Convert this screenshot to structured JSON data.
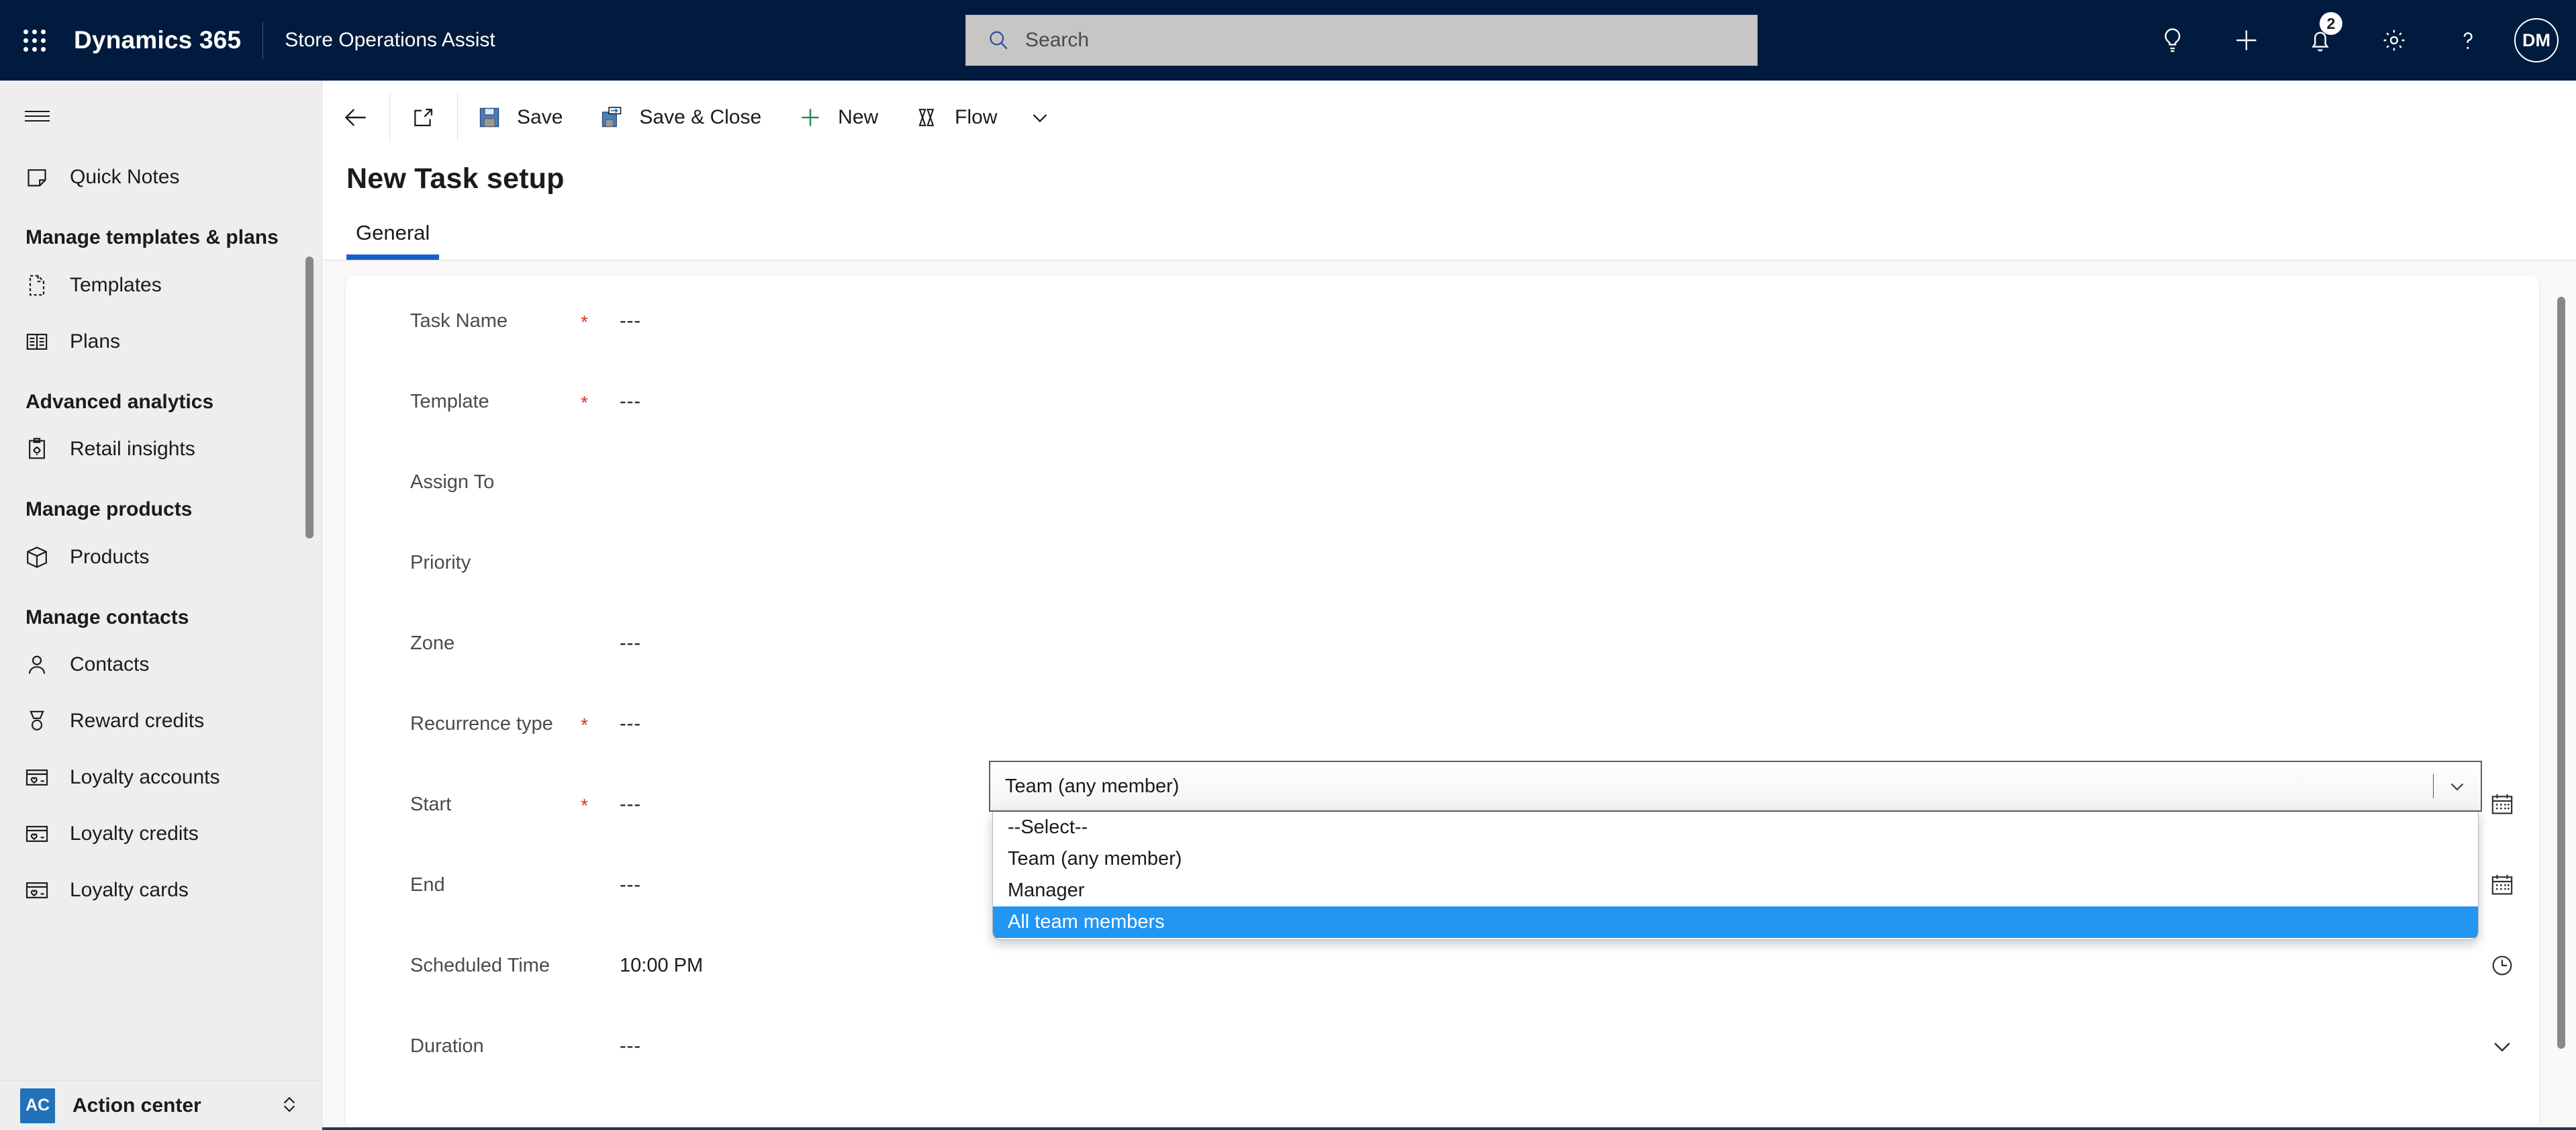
{
  "header": {
    "waffle_icon": "app-launcher-icon",
    "brand": "Dynamics 365",
    "app_name": "Store Operations Assist",
    "search": {
      "placeholder": "Search",
      "value": "",
      "icon": "search-icon"
    },
    "actions": [
      {
        "name": "lightbulb-icon",
        "label": "Insights"
      },
      {
        "name": "plus-icon",
        "label": "New"
      },
      {
        "name": "bell-icon",
        "label": "Notifications",
        "badge": "2"
      },
      {
        "name": "gear-icon",
        "label": "Settings"
      },
      {
        "name": "question-icon",
        "label": "Help"
      }
    ],
    "avatar_initials": "DM"
  },
  "sidebar": {
    "hamburger_icon": "hamburger-icon",
    "items": [
      {
        "type": "item",
        "label": "Quick Notes",
        "icon": "note-icon"
      },
      {
        "type": "group",
        "label": "Manage templates & plans"
      },
      {
        "type": "item",
        "label": "Templates",
        "icon": "document-icon"
      },
      {
        "type": "item",
        "label": "Plans",
        "icon": "plan-icon"
      },
      {
        "type": "group",
        "label": "Advanced analytics"
      },
      {
        "type": "item",
        "label": "Retail insights",
        "icon": "clipboard-gear-icon"
      },
      {
        "type": "group",
        "label": "Manage products"
      },
      {
        "type": "item",
        "label": "Products",
        "icon": "box-icon"
      },
      {
        "type": "group",
        "label": "Manage contacts"
      },
      {
        "type": "item",
        "label": "Contacts",
        "icon": "person-icon"
      },
      {
        "type": "item",
        "label": "Reward credits",
        "icon": "medal-icon"
      },
      {
        "type": "item",
        "label": "Loyalty accounts",
        "icon": "card-heart-icon"
      },
      {
        "type": "item",
        "label": "Loyalty credits",
        "icon": "card-heart-icon"
      },
      {
        "type": "item",
        "label": "Loyalty cards",
        "icon": "card-heart-icon"
      }
    ],
    "footer": {
      "badge": "AC",
      "label": "Action center",
      "chevron_icon": "chevron-up-down-icon"
    }
  },
  "commandbar": {
    "back_icon": "back-arrow-icon",
    "popout_icon": "pop-out-icon",
    "buttons": [
      {
        "label": "Save",
        "icon": "save-icon"
      },
      {
        "label": "Save & Close",
        "icon": "save-close-icon"
      },
      {
        "label": "New",
        "icon": "plus-icon"
      },
      {
        "label": "Flow",
        "icon": "flow-icon"
      }
    ],
    "overflow_icon": "chevron-down-icon"
  },
  "form": {
    "title": "New Task setup",
    "tabs": [
      {
        "label": "General",
        "active": true
      }
    ],
    "rows": [
      {
        "label": "Task Name",
        "required": true,
        "value": "---",
        "icon": ""
      },
      {
        "label": "Template",
        "required": true,
        "value": "---",
        "icon": ""
      },
      {
        "label": "Assign To",
        "required": false,
        "value": "",
        "icon": ""
      },
      {
        "label": "Priority",
        "required": false,
        "value": "",
        "icon": ""
      },
      {
        "label": "Zone",
        "required": false,
        "value": "---",
        "icon": ""
      },
      {
        "label": "Recurrence type",
        "required": true,
        "value": "---",
        "icon": ""
      },
      {
        "label": "Start",
        "required": true,
        "value": "---",
        "icon": "calendar-icon"
      },
      {
        "label": "End",
        "required": false,
        "value": "---",
        "icon": "calendar-icon"
      },
      {
        "label": "Scheduled Time",
        "required": false,
        "value": "10:00 PM",
        "icon": "clock-icon"
      },
      {
        "label": "Duration",
        "required": false,
        "value": "---",
        "icon": "chevron-down-icon"
      }
    ]
  },
  "assign_to_select": {
    "value": "Team (any member)",
    "chevron_icon": "chevron-down-icon",
    "expanded": true,
    "options": [
      {
        "label": "--Select--",
        "selected": false
      },
      {
        "label": "Team (any member)",
        "selected": false
      },
      {
        "label": "Manager",
        "selected": false
      },
      {
        "label": "All team members",
        "selected": true
      }
    ]
  },
  "colors": {
    "header_bg": "#001b3d",
    "accent_blue": "#1a5fd0",
    "selection_blue": "#2296f3",
    "required_red": "#d0342c",
    "action_center_badge": "#2372b9",
    "canvas": "#faf9f8"
  }
}
